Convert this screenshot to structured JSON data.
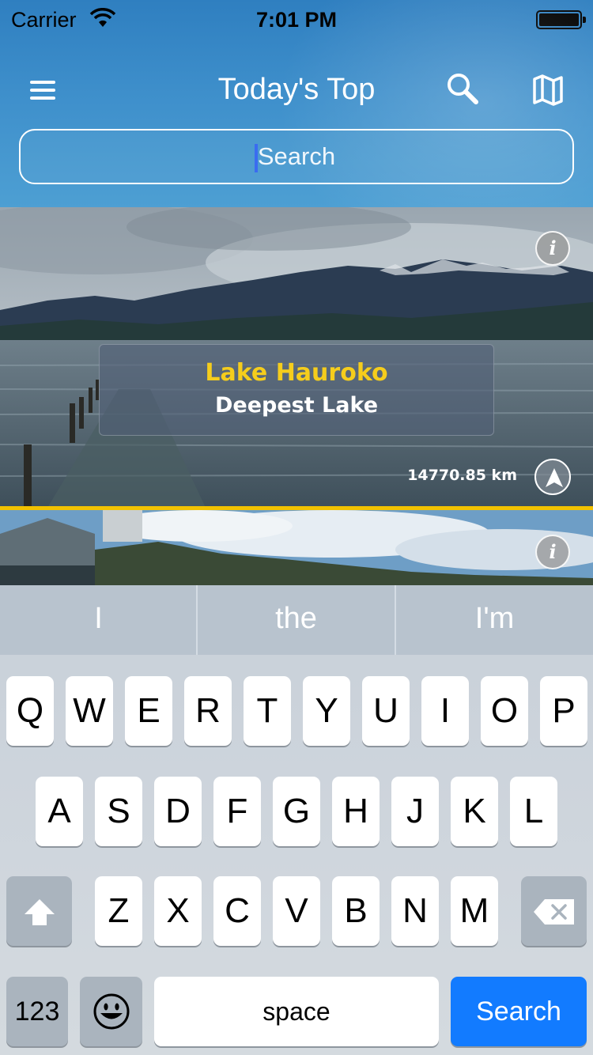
{
  "status_bar": {
    "carrier": "Carrier",
    "time": "7:01 PM"
  },
  "header": {
    "title": "Today's Top",
    "icons": [
      "menu-icon",
      "search-icon",
      "map-icon"
    ],
    "search": {
      "placeholder": "Search",
      "value": ""
    }
  },
  "cards": [
    {
      "name": "Lake Hauroko",
      "subtitle": "Deepest Lake",
      "distance": "14770.85 km",
      "info_label": "i"
    },
    {
      "info_label": "i"
    }
  ],
  "colors": {
    "header_blue": "#3e8fcb",
    "highlight_yellow": "#f5cd1c",
    "divider_gold": "#f2c200",
    "keyboard_search_blue": "#127bff"
  },
  "keyboard": {
    "suggestions": [
      "I",
      "the",
      "I'm"
    ],
    "row1": [
      "Q",
      "W",
      "E",
      "R",
      "T",
      "Y",
      "U",
      "I",
      "O",
      "P"
    ],
    "row2": [
      "A",
      "S",
      "D",
      "F",
      "G",
      "H",
      "J",
      "K",
      "L"
    ],
    "row3": [
      "Z",
      "X",
      "C",
      "V",
      "B",
      "N",
      "M"
    ],
    "numbers_label": "123",
    "space_label": "space",
    "search_label": "Search",
    "icons": [
      "shift-icon",
      "delete-icon",
      "emoji-icon"
    ]
  }
}
